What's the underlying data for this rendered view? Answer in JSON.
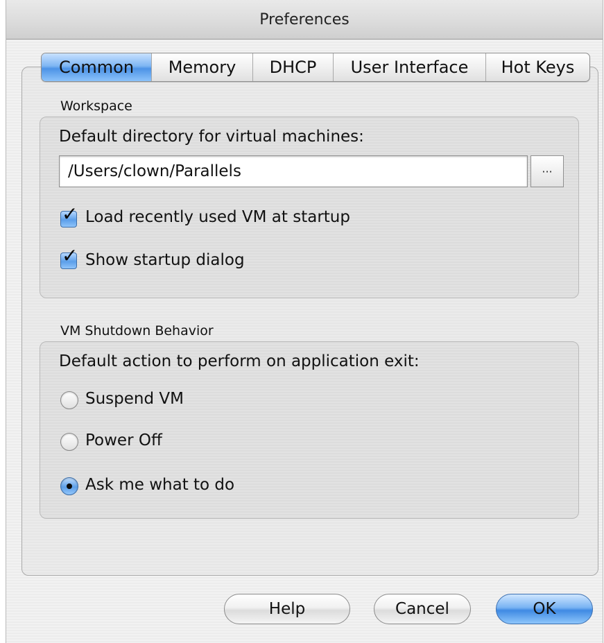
{
  "window": {
    "title": "Preferences"
  },
  "tabs": [
    {
      "label": "Common",
      "active": true
    },
    {
      "label": "Memory",
      "active": false
    },
    {
      "label": "DHCP",
      "active": false
    },
    {
      "label": "User Interface",
      "active": false
    },
    {
      "label": "Hot Keys",
      "active": false
    }
  ],
  "workspace": {
    "group_label": "Workspace",
    "dir_label": "Default directory for virtual machines:",
    "dir_value": "/Users/clown/Parallels",
    "browse_label": "···",
    "load_recent_label": "Load recently used VM at startup",
    "load_recent_checked": true,
    "show_dialog_label": "Show startup dialog",
    "show_dialog_checked": true
  },
  "shutdown": {
    "group_label": "VM Shutdown Behavior",
    "prompt": "Default action to perform on application exit:",
    "options": [
      {
        "label": "Suspend VM",
        "selected": false
      },
      {
        "label": "Power Off",
        "selected": false
      },
      {
        "label": "Ask me what to do",
        "selected": true
      }
    ]
  },
  "buttons": {
    "help": "Help",
    "cancel": "Cancel",
    "ok": "OK"
  },
  "colors": {
    "accent": "#4d93e6",
    "window_bg": "#ececec"
  },
  "icons": {
    "check": "checkmark-icon",
    "radio_dot": "radio-dot-icon"
  }
}
